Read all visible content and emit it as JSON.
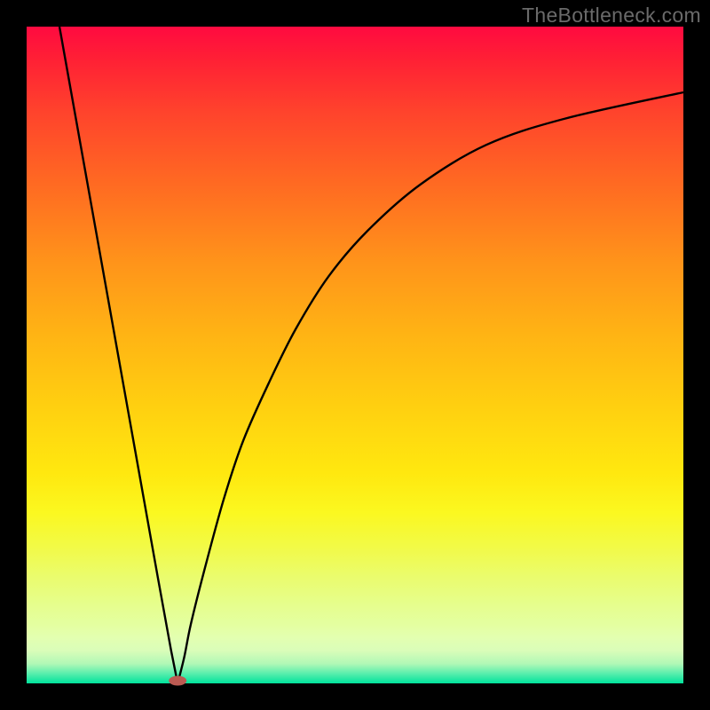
{
  "watermark": "TheBottleneck.com",
  "chart_data": {
    "type": "line",
    "title": "",
    "xlabel": "",
    "ylabel": "",
    "xlim": [
      0,
      100
    ],
    "ylim": [
      0,
      100
    ],
    "grid": false,
    "legend": false,
    "colors": {
      "curve": "#000000",
      "marker": "#bb5a52",
      "gradient_top": "#ff0a40",
      "gradient_bottom": "#00e39c"
    },
    "minimum": {
      "x": 23,
      "y": 0
    },
    "series": [
      {
        "name": "bottleneck",
        "x": [
          5,
          10,
          15,
          20,
          22,
          23,
          24,
          25,
          27,
          30,
          33,
          37,
          41,
          46,
          52,
          60,
          70,
          82,
          100
        ],
        "y": [
          100,
          72,
          44,
          16,
          5,
          0,
          4,
          9,
          17,
          28,
          37,
          46,
          54,
          62,
          69,
          76,
          82,
          86,
          90
        ]
      }
    ]
  }
}
